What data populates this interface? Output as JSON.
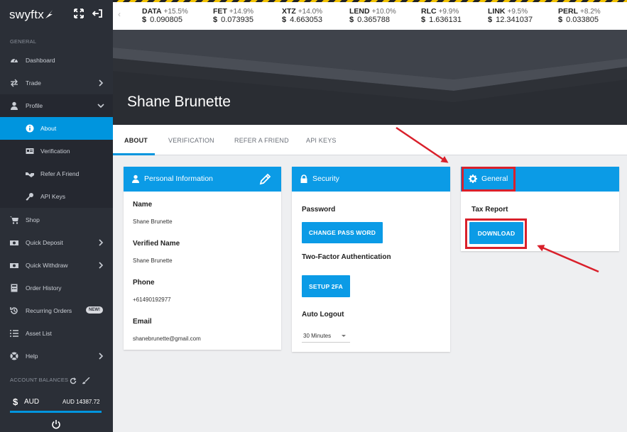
{
  "app": {
    "logo": "swyftx"
  },
  "sidebar": {
    "general_label": "GENERAL",
    "items": [
      {
        "label": "Dashboard",
        "icon": "dashboard-icon"
      },
      {
        "label": "Trade",
        "icon": "swap-arrows-icon"
      },
      {
        "label": "Profile",
        "icon": "user-icon"
      },
      {
        "label": "About",
        "icon": "info-icon"
      },
      {
        "label": "Verification",
        "icon": "id-card-icon"
      },
      {
        "label": "Refer A Friend",
        "icon": "handshake-icon"
      },
      {
        "label": "API Keys",
        "icon": "key-icon"
      },
      {
        "label": "Shop",
        "icon": "cart-icon"
      },
      {
        "label": "Quick Deposit",
        "icon": "money-icon"
      },
      {
        "label": "Quick Withdraw",
        "icon": "money-icon"
      },
      {
        "label": "Order History",
        "icon": "calculator-icon"
      },
      {
        "label": "Recurring Orders",
        "icon": "history-icon",
        "badge": "NEW!"
      },
      {
        "label": "Asset List",
        "icon": "list-icon"
      },
      {
        "label": "Help",
        "icon": "help-icon"
      }
    ],
    "balances_label": "ACCOUNT BALANCES",
    "balance": {
      "currency_symbol": "$",
      "currency": "AUD",
      "amount": "AUD 14387.72"
    }
  },
  "ticker": [
    {
      "symbol": "DATA",
      "change": "+15.5%",
      "price": "0.090805"
    },
    {
      "symbol": "FET",
      "change": "+14.9%",
      "price": "0.073935"
    },
    {
      "symbol": "XTZ",
      "change": "+14.0%",
      "price": "4.663053"
    },
    {
      "symbol": "LEND",
      "change": "+10.0%",
      "price": "0.365788"
    },
    {
      "symbol": "RLC",
      "change": "+9.9%",
      "price": "1.636131"
    },
    {
      "symbol": "LINK",
      "change": "+9.5%",
      "price": "12.341037"
    },
    {
      "symbol": "PERL",
      "change": "+8.2%",
      "price": "0.033805"
    }
  ],
  "ticker_currency": "$",
  "profile": {
    "name": "Shane Brunette"
  },
  "tabs": [
    "ABOUT",
    "VERIFICATION",
    "REFER A FRIEND",
    "API KEYS"
  ],
  "personal": {
    "title": "Personal Information",
    "name_label": "Name",
    "name": "Shane Brunette",
    "verified_label": "Verified Name",
    "verified": "Shane Brunette",
    "phone_label": "Phone",
    "phone": "+61490192977",
    "email_label": "Email",
    "email": "shanebrunette@gmail.com"
  },
  "security": {
    "title": "Security",
    "password_label": "Password",
    "change_password_button": "CHANGE PASS WORD",
    "twofa_label": "Two-Factor Authentication",
    "setup_2fa_button": "SETUP 2FA",
    "auto_logout_label": "Auto Logout",
    "auto_logout_value": "30 Minutes"
  },
  "general": {
    "title": "General",
    "tax_label": "Tax Report",
    "download_button": "DOWNLOAD"
  },
  "colors": {
    "accent": "#0b9be6",
    "sidebar": "#2b2f37",
    "highlight": "#d9202b"
  }
}
